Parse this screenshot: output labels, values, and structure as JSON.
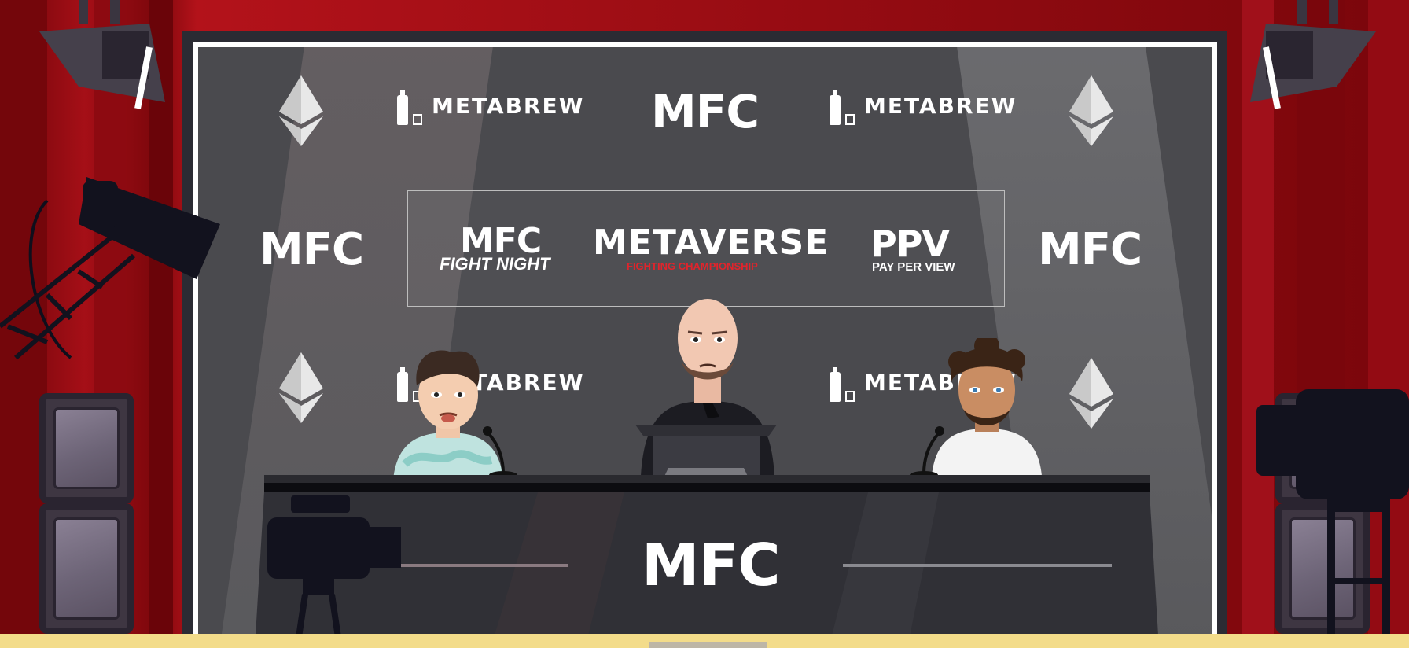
{
  "backdrop": {
    "sponsor_brand": "METABREW",
    "event_brand": "MFC",
    "crypto_icon": "ethereum-icon"
  },
  "banner": {
    "left_title": "MFC",
    "left_subtitle": "FIGHT NIGHT",
    "center_title": "METAVERSE",
    "center_subtitle": "FIGHTING CHAMPIONSHIP",
    "right_title": "PPV",
    "right_subtitle": "PAY PER VIEW"
  },
  "desk": {
    "logo": "MFC"
  },
  "colors": {
    "curtain": "#9e0d15",
    "backdrop": "#4a4a4e",
    "accent_red": "#e0242c",
    "floor": "#f3dc8a"
  }
}
